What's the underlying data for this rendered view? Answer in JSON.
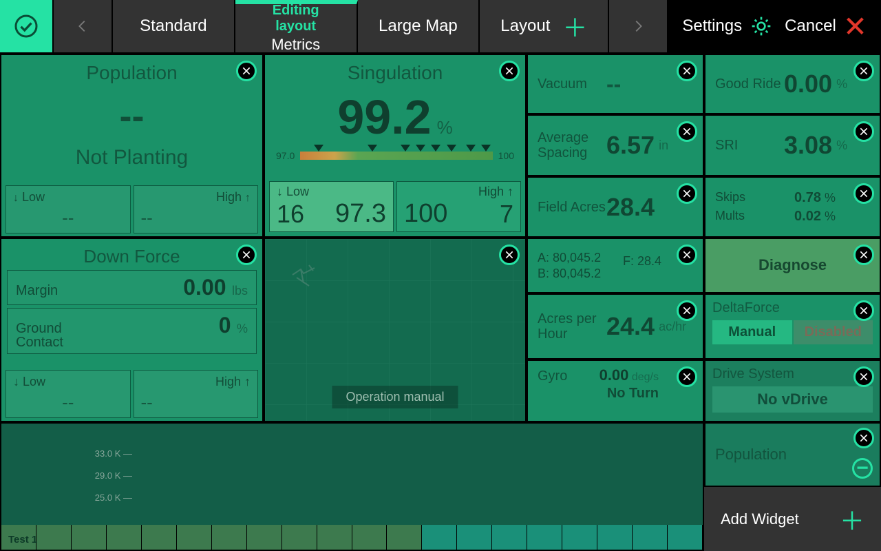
{
  "topbar": {
    "tabs": {
      "standard": "Standard",
      "metrics_top": "Editing layout",
      "metrics_bottom": "Metrics",
      "large_map": "Large Map",
      "layout": "Layout"
    },
    "settings": "Settings",
    "cancel": "Cancel"
  },
  "population": {
    "title": "Population",
    "value": "--",
    "status": "Not Planting",
    "low_label": "Low",
    "high_label": "High",
    "low_val": "--",
    "high_val": "--"
  },
  "singulation": {
    "title": "Singulation",
    "value": "99.2",
    "unit": "%",
    "scale_low": "97.0",
    "scale_high": "100",
    "low_label": "Low",
    "low_row": "16",
    "low_val": "97.3",
    "high_label": "High",
    "high_val": "100",
    "high_row": "7"
  },
  "downforce": {
    "title": "Down Force",
    "margin_label": "Margin",
    "margin_val": "0.00",
    "margin_unit": "lbs",
    "ground_label": "Ground Contact",
    "ground_val": "0",
    "ground_unit": "%",
    "low_label": "Low",
    "high_label": "High",
    "low_val": "--",
    "high_val": "--"
  },
  "map": {
    "manual": "Operation manual"
  },
  "right": {
    "vacuum": {
      "label": "Vacuum",
      "value": "--"
    },
    "good_ride": {
      "label": "Good Ride",
      "value": "0.00",
      "unit": "%"
    },
    "avg_spacing": {
      "label": "Average Spacing",
      "value": "6.57",
      "unit": "in"
    },
    "sri": {
      "label": "SRI",
      "value": "3.08",
      "unit": "%"
    },
    "field_acres": {
      "label": "Field Acres",
      "value": "28.4"
    },
    "skips": {
      "label": "Skips",
      "value": "0.78",
      "unit": "%"
    },
    "mults": {
      "label": "Mults",
      "value": "0.02",
      "unit": "%"
    },
    "ab": {
      "a": "A: 80,045.2",
      "b": "B: 80,045.2",
      "f": "F: 28.4"
    },
    "diagnose": "Diagnose",
    "acres_hour": {
      "label": "Acres per Hour",
      "value": "24.4",
      "unit": "ac/hr"
    },
    "deltaforce": {
      "title": "DeltaForce",
      "manual": "Manual",
      "disabled": "Disabled"
    },
    "gyro": {
      "label": "Gyro",
      "value": "0.00",
      "unit": "deg/s",
      "status": "No Turn"
    },
    "drive": {
      "title": "Drive System",
      "button": "No vDrive"
    },
    "population_mini": "Population",
    "add_widget": "Add Widget"
  },
  "chart_data": {
    "type": "bar",
    "y_ticks": [
      "33.0 K",
      "29.0 K",
      "25.0 K"
    ],
    "label": "Test 1",
    "row_count": 20
  }
}
